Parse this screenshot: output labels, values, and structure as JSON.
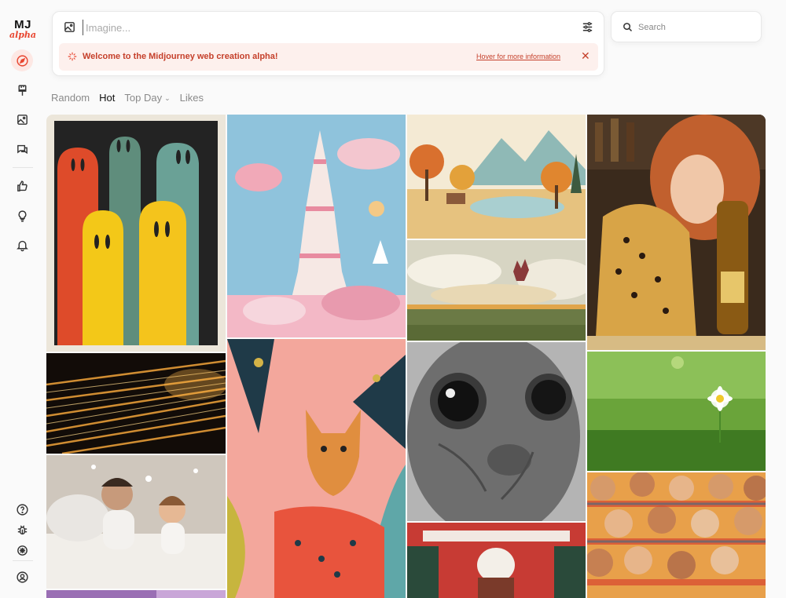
{
  "app": {
    "logo_text": "MJ",
    "logo_sub": "alpha",
    "accent": "#e8452f"
  },
  "sidebar": {
    "top_items": [
      {
        "name": "explore",
        "icon": "compass-icon"
      },
      {
        "name": "create",
        "icon": "paintbrush-icon"
      },
      {
        "name": "organize",
        "icon": "image-icon"
      },
      {
        "name": "chat",
        "icon": "chat-bubbles-icon"
      }
    ],
    "mid_items": [
      {
        "name": "rank",
        "icon": "thumbs-up-icon"
      },
      {
        "name": "tasks",
        "icon": "lightbulb-icon"
      },
      {
        "name": "updates",
        "icon": "bell-icon"
      }
    ],
    "bottom_items": [
      {
        "name": "help",
        "icon": "help-circle-icon"
      },
      {
        "name": "bug-report",
        "icon": "bug-icon"
      },
      {
        "name": "theme",
        "icon": "sun-icon"
      },
      {
        "name": "account",
        "icon": "user-circle-icon"
      }
    ]
  },
  "prompt": {
    "placeholder": "Imagine...",
    "banner_message": "Welcome to the Midjourney web creation alpha!",
    "banner_link": "Hover for more information",
    "banner_close": "✕"
  },
  "search": {
    "placeholder": "Search"
  },
  "tabs": [
    {
      "label": "Random",
      "active": false
    },
    {
      "label": "Hot",
      "active": true
    },
    {
      "label": "Top Day",
      "active": false,
      "dropdown": "⌄"
    },
    {
      "label": "Likes",
      "active": false
    }
  ],
  "gallery": [
    {
      "name": "ghost-figures-painting"
    },
    {
      "name": "candy-castle-image"
    },
    {
      "name": "autumn-landscape-image"
    },
    {
      "name": "woman-cheetah-image"
    },
    {
      "name": "floating-castle-clouds-image"
    },
    {
      "name": "light-streaks-image"
    },
    {
      "name": "lynx-pattern-image"
    },
    {
      "name": "alien-closeup-image"
    },
    {
      "name": "daisy-grass-image"
    },
    {
      "name": "father-daughter-pillow-fight-image"
    },
    {
      "name": "crowd-portraits-image"
    },
    {
      "name": "red-interior-image"
    },
    {
      "name": "purple-flowers-image"
    },
    {
      "name": "garden-image"
    }
  ]
}
